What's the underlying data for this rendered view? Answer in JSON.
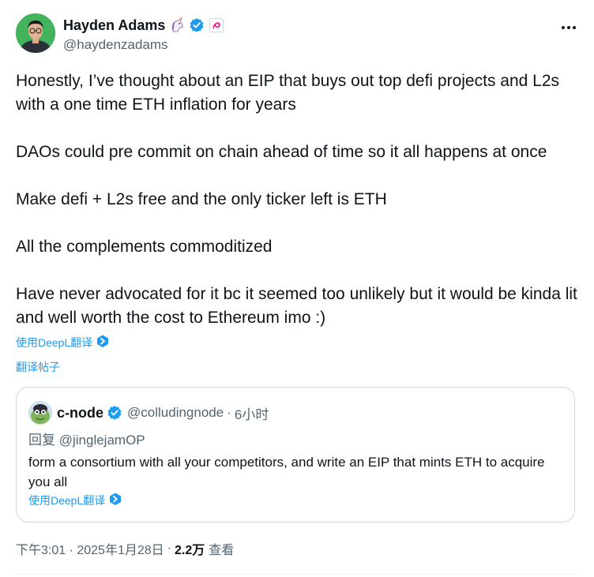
{
  "author": {
    "display_name": "Hayden Adams",
    "handle": "@haydenzadams",
    "emoji_icon": "unicorn-icon",
    "verified_icon": "verified-badge-icon",
    "affiliate_icon": "uniswap-affiliate-icon"
  },
  "post": {
    "paragraphs": [
      "Honestly, I’ve thought about an EIP that buys out top defi projects and L2s with a one time ETH inflation for years",
      "DAOs could pre commit on chain ahead of time so it all happens at once",
      "Make defi + L2s free and the only ticker left is ETH",
      "All the complements commoditized",
      "Have never advocated for it bc it seemed too unlikely but it would be kinda lit and well worth the cost to Ethereum imo :)"
    ],
    "translate_label": "使用DeepL翻译",
    "translate_post_label": "翻译帖子"
  },
  "quote": {
    "display_name": "c-node",
    "handle": "@colludingnode",
    "separator": "·",
    "time": "6小时",
    "reply_to": "回复 @jinglejamOP",
    "text": "form a consortium with all your competitors, and write an EIP that mints ETH to acquire you all",
    "translate_label": "使用DeepL翻译"
  },
  "meta": {
    "timestamp": "下午3:01 · 2025年1月28日",
    "separator": "·",
    "views_count": "2.2万",
    "views_label": "查看"
  },
  "colors": {
    "link": "#1d9bf0",
    "secondary_text": "#536471",
    "primary_text": "#0f1419",
    "border": "#cfd9de"
  }
}
